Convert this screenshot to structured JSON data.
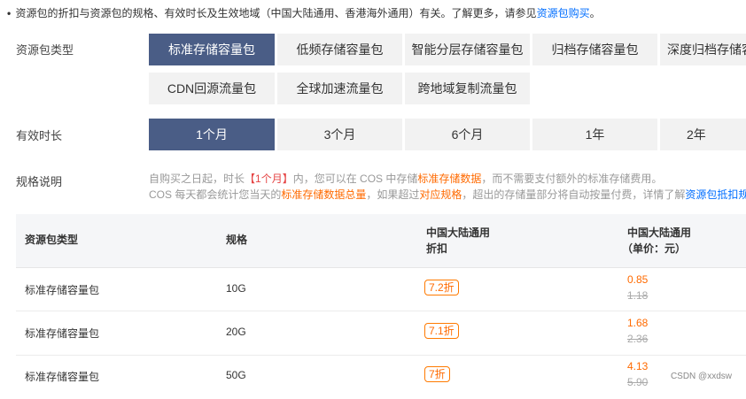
{
  "intro": {
    "bullet": "•",
    "text": "资源包的折扣与资源包的规格、有效时长及生效地域（中国大陆通用、香港海外通用）有关。了解更多，请参见",
    "link": "资源包购买",
    "end": "。"
  },
  "package_type": {
    "label": "资源包类型",
    "options": [
      "标准存储容量包",
      "低频存储容量包",
      "智能分层存储容量包",
      "归档存储容量包",
      "深度归档存储容",
      "CDN回源流量包",
      "全球加速流量包",
      "跨地域复制流量包"
    ],
    "selected": "标准存储容量包"
  },
  "duration": {
    "label": "有效时长",
    "options": [
      "1个月",
      "3个月",
      "6个月",
      "1年",
      "2年"
    ],
    "selected": "1个月"
  },
  "spec": {
    "label": "规格说明",
    "line1": {
      "a": "自购买之日起，时长",
      "b": "【1个月】",
      "c": "内，您可以在 COS 中存储",
      "d": "标准存储数据",
      "e": "，而不需要支付额外的标准存储费用。"
    },
    "line2": {
      "a": "COS 每天都会统计您当天的",
      "b": "标准存储数据总量",
      "c": "，如果超过",
      "d": "对应规格",
      "e": "，超出的存储量部分将自动按量付费，详情了解",
      "f": "资源包抵扣规"
    }
  },
  "table": {
    "headers": {
      "type": "资源包类型",
      "spec": "规格",
      "discount_l1": "中国大陆通用",
      "discount_l2": "折扣",
      "price_l1": "中国大陆通用",
      "price_l2": "（单价：元）"
    },
    "rows": [
      {
        "type": "标准存储容量包",
        "spec": "10G",
        "discount": "7.2折",
        "price": "0.85",
        "original": "1.18"
      },
      {
        "type": "标准存储容量包",
        "spec": "20G",
        "discount": "7.1折",
        "price": "1.68",
        "original": "2.36"
      },
      {
        "type": "标准存储容量包",
        "spec": "50G",
        "discount": "7折",
        "price": "4.13",
        "original": "5.90"
      }
    ]
  },
  "watermark": "CSDN @xxdsw"
}
